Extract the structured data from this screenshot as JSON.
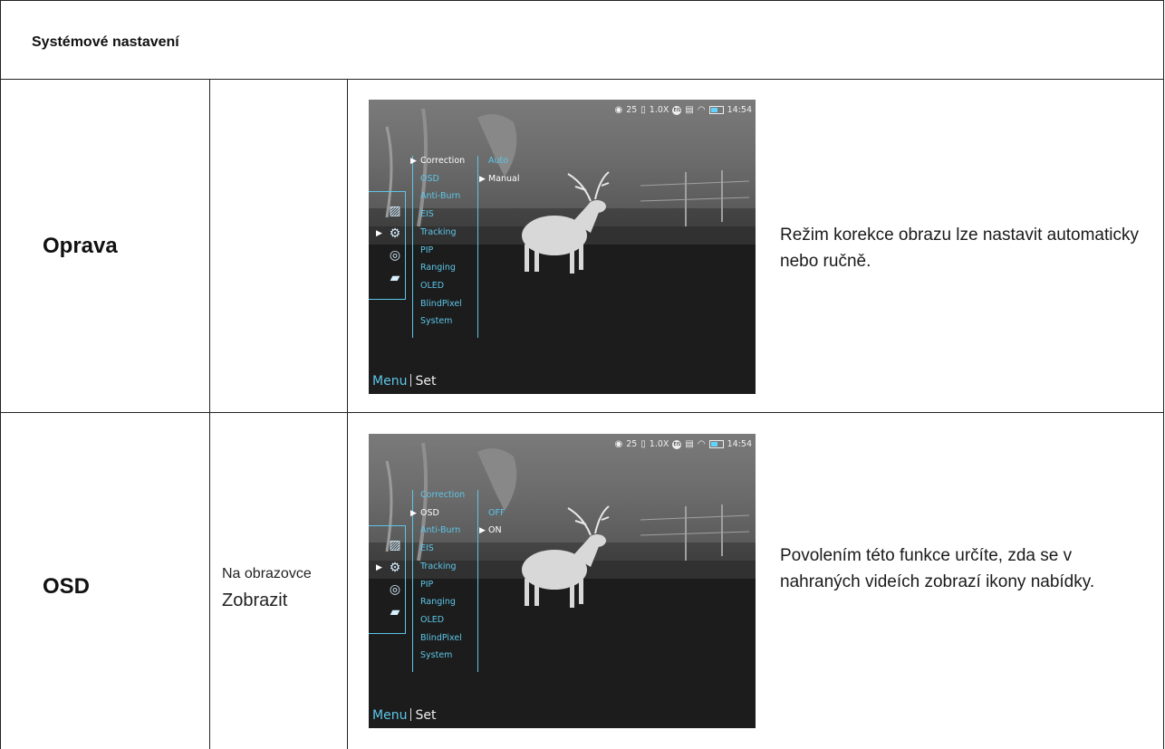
{
  "header": {
    "title": "Systémové nastavení"
  },
  "rows": [
    {
      "name": "Oprava",
      "subtitle_line1": "",
      "subtitle_line2": "",
      "description": "Režim korekce obrazu lze nastavit automaticky nebo ručně.",
      "screen": {
        "status": {
          "icon_battery_level": 0.5,
          "time": "14:54",
          "counter": "25",
          "zoom": "1.0X",
          "eis": "EIS"
        },
        "menu_items": [
          "Correction",
          "OSD",
          "Anti-Burn",
          "EIS",
          "Tracking",
          "PIP",
          "Ranging",
          "OLED",
          "BlindPixel",
          "System"
        ],
        "selected_index": 0,
        "options": [
          "Auto",
          "Manual"
        ],
        "selected_option": 1,
        "footer_menu": "Menu",
        "footer_set": "Set"
      }
    },
    {
      "name": "OSD",
      "subtitle_line1": "Na obrazovce",
      "subtitle_line2": "Zobrazit",
      "description": "Povolením této funkce určíte, zda se v nahraných videích zobrazí ikony nabídky.",
      "screen": {
        "status": {
          "icon_battery_level": 0.5,
          "time": "14:54",
          "counter": "25",
          "zoom": "1.0X",
          "eis": "EIS"
        },
        "menu_items": [
          "Correction",
          "OSD",
          "Anti-Burn",
          "EIS",
          "Tracking",
          "PIP",
          "Ranging",
          "OLED",
          "BlindPixel",
          "System"
        ],
        "selected_index": 1,
        "options": [
          "OFF",
          "ON"
        ],
        "selected_option": 1,
        "footer_menu": "Menu",
        "footer_set": "Set"
      }
    }
  ],
  "icons": [
    "image-icon",
    "gear-icon",
    "globe-icon",
    "folder-icon",
    "wifi-icon",
    "battery-icon",
    "video-icon"
  ]
}
